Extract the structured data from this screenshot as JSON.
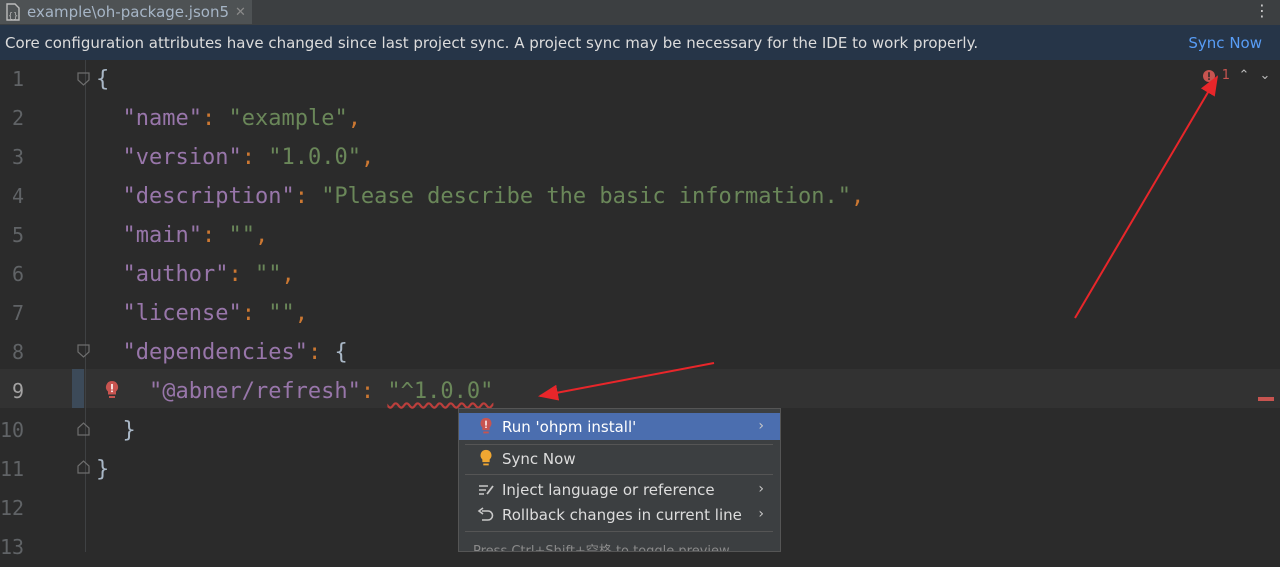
{
  "tab": {
    "title": "example\\oh-package.json5",
    "icon": "json5-file-icon",
    "close": "✕"
  },
  "more_icon": "⋮",
  "banner": {
    "message": "Core configuration attributes have changed since last project sync. A project sync may be necessary for the IDE to work properly.",
    "action": "Sync Now"
  },
  "inspection": {
    "error_count": "1",
    "up": "⌃",
    "down": "⌄"
  },
  "editor": {
    "current_line": 9,
    "lines": [
      {
        "num": "1",
        "tokens": [
          {
            "t": "{",
            "c": "b"
          }
        ]
      },
      {
        "num": "2",
        "tokens": [
          {
            "t": "  ",
            "c": "b"
          },
          {
            "t": "\"name\"",
            "c": "k"
          },
          {
            "t": ": ",
            "c": "p"
          },
          {
            "t": "\"example\"",
            "c": "s"
          },
          {
            "t": ",",
            "c": "p"
          }
        ]
      },
      {
        "num": "3",
        "tokens": [
          {
            "t": "  ",
            "c": "b"
          },
          {
            "t": "\"version\"",
            "c": "k"
          },
          {
            "t": ": ",
            "c": "p"
          },
          {
            "t": "\"1.0.0\"",
            "c": "s"
          },
          {
            "t": ",",
            "c": "p"
          }
        ]
      },
      {
        "num": "4",
        "tokens": [
          {
            "t": "  ",
            "c": "b"
          },
          {
            "t": "\"description\"",
            "c": "k"
          },
          {
            "t": ": ",
            "c": "p"
          },
          {
            "t": "\"Please describe the basic information.\"",
            "c": "s"
          },
          {
            "t": ",",
            "c": "p"
          }
        ]
      },
      {
        "num": "5",
        "tokens": [
          {
            "t": "  ",
            "c": "b"
          },
          {
            "t": "\"main\"",
            "c": "k"
          },
          {
            "t": ": ",
            "c": "p"
          },
          {
            "t": "\"\"",
            "c": "s"
          },
          {
            "t": ",",
            "c": "p"
          }
        ]
      },
      {
        "num": "6",
        "tokens": [
          {
            "t": "  ",
            "c": "b"
          },
          {
            "t": "\"author\"",
            "c": "k"
          },
          {
            "t": ": ",
            "c": "p"
          },
          {
            "t": "\"\"",
            "c": "s"
          },
          {
            "t": ",",
            "c": "p"
          }
        ]
      },
      {
        "num": "7",
        "tokens": [
          {
            "t": "  ",
            "c": "b"
          },
          {
            "t": "\"license\"",
            "c": "k"
          },
          {
            "t": ": ",
            "c": "p"
          },
          {
            "t": "\"\"",
            "c": "s"
          },
          {
            "t": ",",
            "c": "p"
          }
        ]
      },
      {
        "num": "8",
        "tokens": [
          {
            "t": "  ",
            "c": "b"
          },
          {
            "t": "\"dependencies\"",
            "c": "k"
          },
          {
            "t": ": ",
            "c": "p"
          },
          {
            "t": "{",
            "c": "b"
          }
        ]
      },
      {
        "num": "9",
        "tokens": [
          {
            "t": "    ",
            "c": "b"
          },
          {
            "t": "\"@abner/refresh\"",
            "c": "k"
          },
          {
            "t": ": ",
            "c": "p"
          },
          {
            "t": "\"^1.0.0\"",
            "c": "s wavy"
          }
        ]
      },
      {
        "num": "10",
        "tokens": [
          {
            "t": "  ",
            "c": "b"
          },
          {
            "t": "}",
            "c": "b"
          }
        ]
      },
      {
        "num": "11",
        "tokens": [
          {
            "t": "}",
            "c": "b"
          }
        ]
      },
      {
        "num": "12",
        "tokens": []
      },
      {
        "num": "13",
        "tokens": []
      }
    ]
  },
  "popup": {
    "items": [
      {
        "label": "Run 'ohpm install'",
        "icon": "error-bulb-icon",
        "submenu": true,
        "selected": true
      },
      {
        "label": "Sync Now",
        "icon": "lightbulb-icon",
        "submenu": false,
        "selected": false
      },
      {
        "label": "Inject language or reference",
        "icon": "inject-language-icon",
        "submenu": true,
        "selected": false
      },
      {
        "label": "Rollback changes in current line",
        "icon": "undo-icon",
        "submenu": true,
        "selected": false
      }
    ],
    "arrow": "›",
    "hint": "Press Ctrl+Shift+空格 to toggle preview"
  },
  "colors": {
    "keyword": "#9876aa",
    "string": "#6a8759",
    "punct": "#cc7832",
    "error": "#c75450",
    "selection": "#4b6eaf",
    "annotation_arrow": "#e8262a"
  }
}
